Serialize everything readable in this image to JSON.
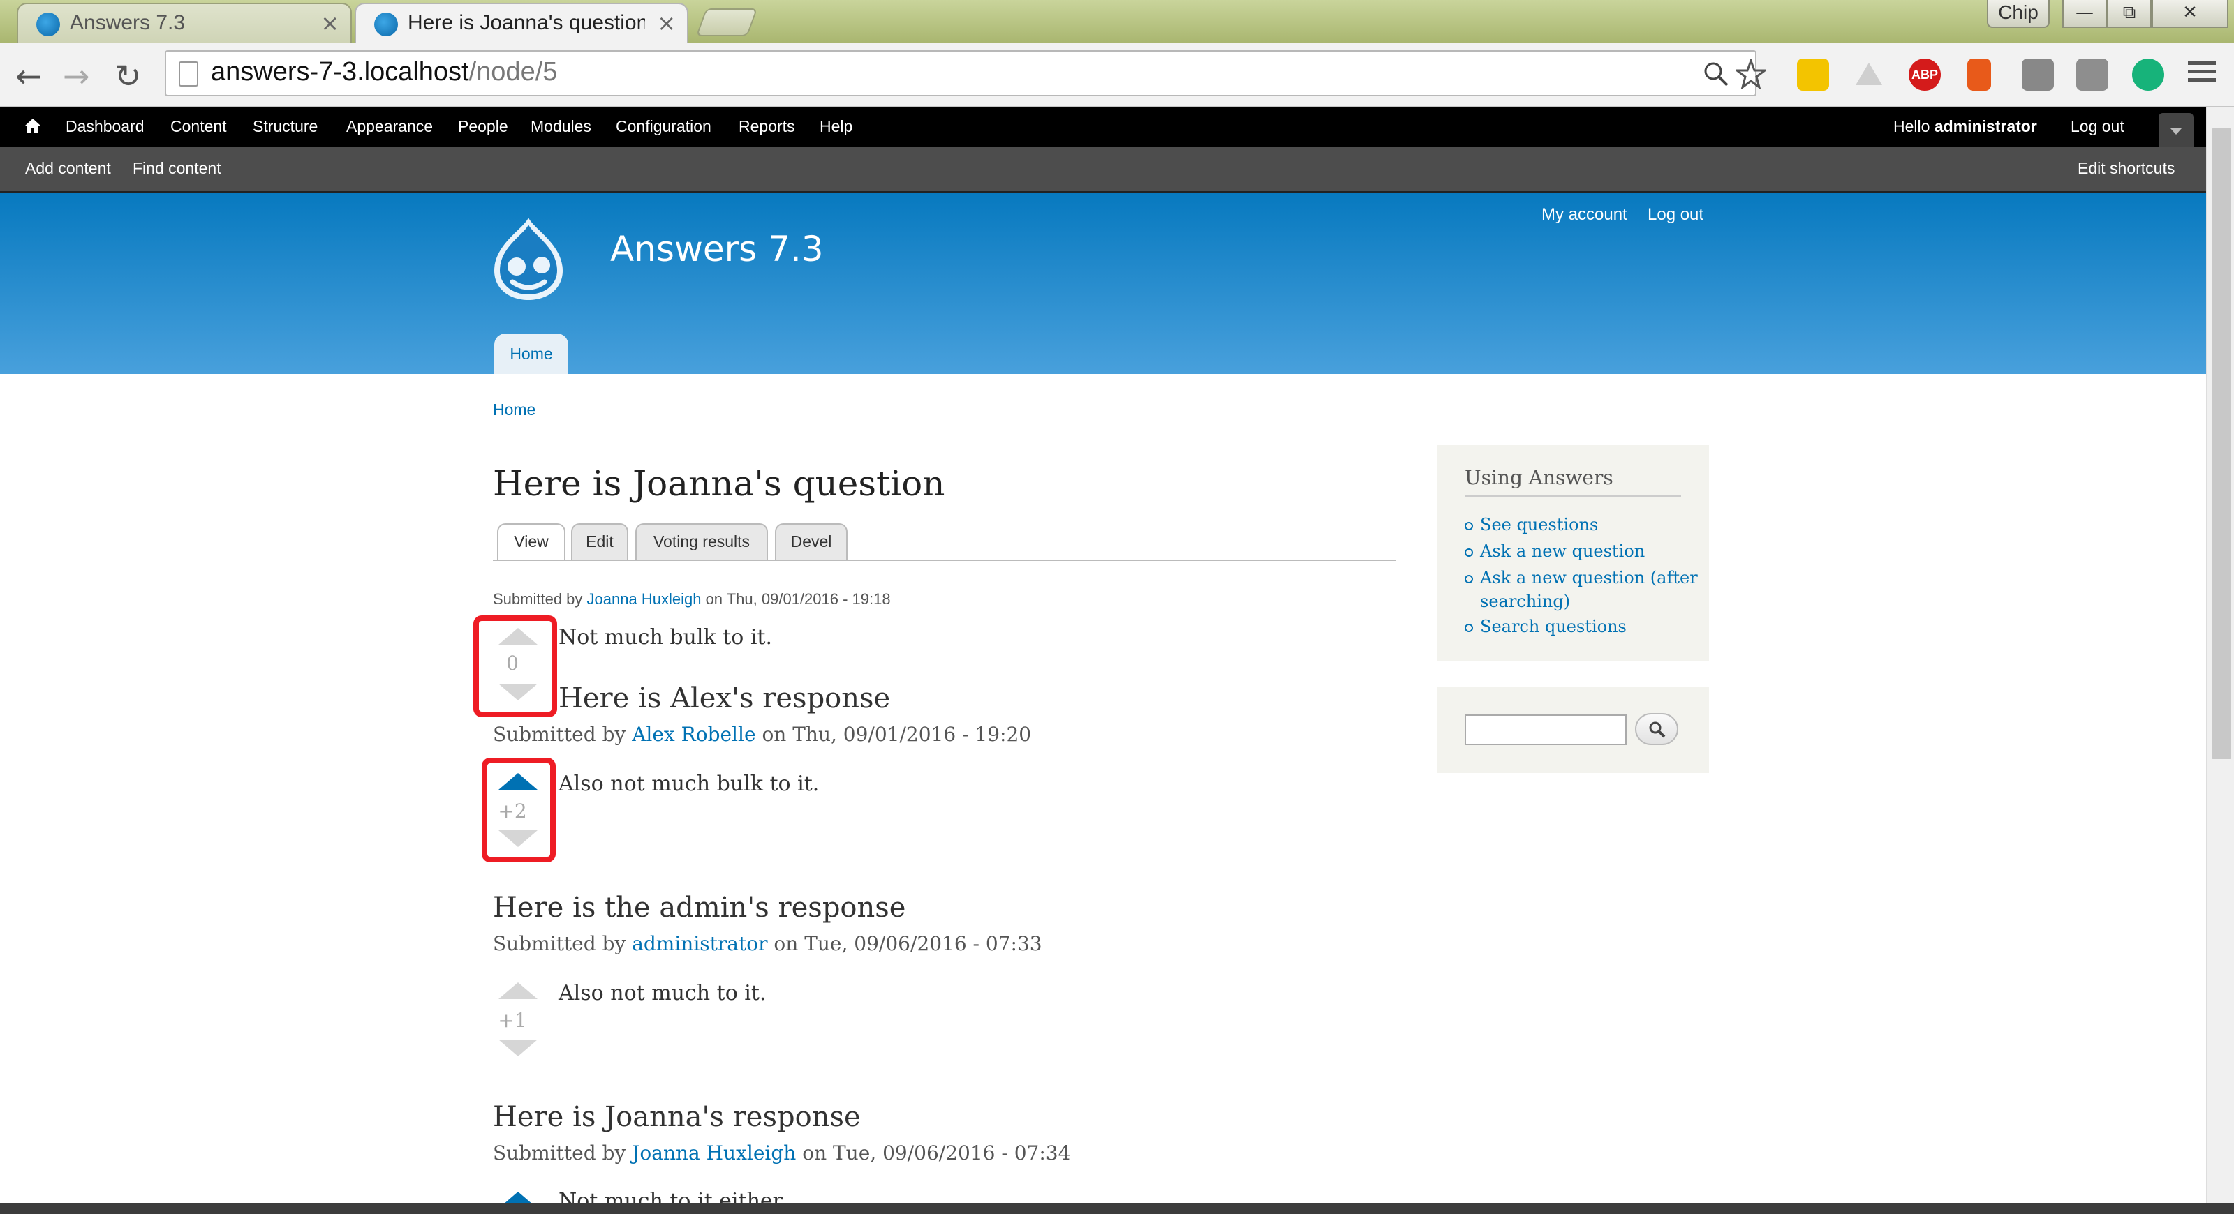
{
  "browser": {
    "tabs": [
      {
        "title": "Answers 7.3",
        "close": "×",
        "active": false
      },
      {
        "title": "Here is Joanna's question",
        "close": "×",
        "active": true
      }
    ],
    "user_button": "Chip",
    "window_controls": {
      "minimize": "—",
      "restore": "⧉",
      "close": "✕"
    },
    "url_host": "answers-7-3.localhost",
    "url_path": "/node/5",
    "extensions": [
      "more-icon",
      "drive-icon",
      "adblock-icon",
      "office-icon",
      "extension-icon",
      "stylus-icon",
      "grammarly-icon"
    ],
    "adblock_label": "ABP"
  },
  "admin_menu": {
    "items": [
      "Dashboard",
      "Content",
      "Structure",
      "Appearance",
      "People",
      "Modules",
      "Configuration",
      "Reports",
      "Help"
    ],
    "hello_prefix": "Hello",
    "username": "administrator",
    "logout": "Log out"
  },
  "shortcuts": {
    "items": [
      "Add content",
      "Find content"
    ],
    "edit": "Edit shortcuts"
  },
  "header": {
    "site_name": "Answers 7.3",
    "secondary_links": [
      "My account",
      "Log out"
    ],
    "main_menu": [
      "Home"
    ]
  },
  "breadcrumb": "Home",
  "question": {
    "title": "Here is Joanna's question",
    "local_tabs": [
      "View",
      "Edit",
      "Voting results",
      "Devel"
    ],
    "submitted_prefix": "Submitted by",
    "author": "Joanna Huxleigh",
    "submitted_suffix": "on Thu, 09/01/2016 - 19:18",
    "body": "Not much bulk to it.",
    "vote_count": "0"
  },
  "answers": [
    {
      "title": "Here is Alex's response",
      "author": "Alex Robelle",
      "date": "on Thu, 09/01/2016 - 19:20",
      "body": "Also not much bulk to it.",
      "vote_count": "+2",
      "upvoted": true
    },
    {
      "title": "Here is the admin's response",
      "author": "administrator",
      "date": "on Tue, 09/06/2016 - 07:33",
      "body": "Also not much to it.",
      "vote_count": "+1",
      "upvoted": false
    },
    {
      "title": "Here is Joanna's response",
      "author": "Joanna Huxleigh",
      "date": "on Tue, 09/06/2016 - 07:34",
      "body": "Not much to it either.",
      "vote_count": "",
      "upvoted": true
    }
  ],
  "sidebar": {
    "block_title": "Using Answers",
    "links": [
      "See questions",
      "Ask a new question",
      "Ask a new question (after",
      "searching)",
      "Search questions"
    ]
  },
  "colors": {
    "highlight": "#ee1c24",
    "link": "#0071b3",
    "header_top": "#0779bf",
    "header_bottom": "#48a0dc"
  }
}
